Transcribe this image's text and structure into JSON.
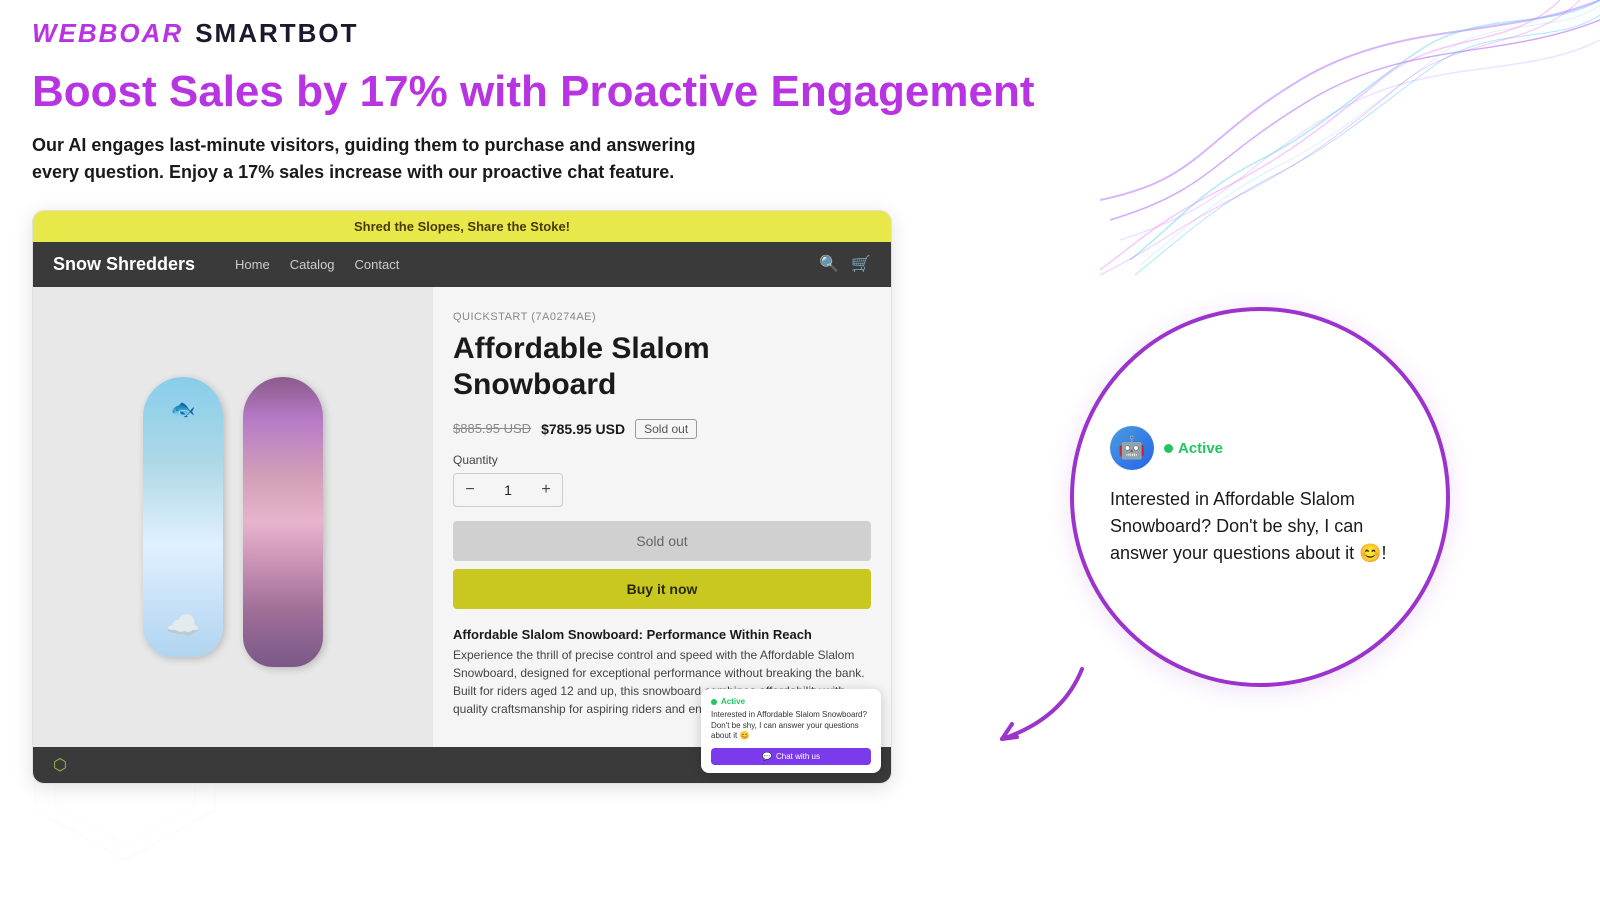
{
  "header": {
    "logo_webboar": "WEBBOAR",
    "logo_smartbot": "SMARTBOT"
  },
  "hero": {
    "title": "Boost Sales by 17% with Proactive Engagement",
    "description": "Our AI engages last-minute visitors, guiding them to purchase and answering every question. Enjoy a 17% sales increase with our proactive chat feature."
  },
  "store": {
    "announcement": "Shred the Slopes, Share the Stoke!",
    "logo": "Snow Shredders",
    "nav": {
      "home": "Home",
      "catalog": "Catalog",
      "contact": "Contact"
    },
    "product": {
      "sku": "QUICKSTART (7A0274AE)",
      "name": "Affordable Slalom Snowboard",
      "price_original": "$885.95 USD",
      "price_current": "$785.95 USD",
      "sold_out_badge": "Sold out",
      "quantity_label": "Quantity",
      "quantity_value": "1",
      "btn_sold_out": "Sold out",
      "btn_buy_now": "Buy it now",
      "desc_title": "Affordable Slalom Snowboard: Performance Within Reach",
      "desc_text": "Experience the thrill of precise control and speed with the Affordable Slalom Snowboard, designed for exceptional performance without breaking the bank. Built for riders aged 12 and up, this snowboard combines affordability with quality craftsmanship for aspiring riders and enthusiasts alike."
    }
  },
  "chat_widget": {
    "active_label": "Active",
    "message": "Interested in Affordable Slalom Snowboard? Don't be shy, I can answer your questions about it 😊!",
    "avatar_emoji": "🤖"
  },
  "mini_chat": {
    "active_label": "Active",
    "message_text": "Interested in Affordable Slalom Snowboard? Don't be shy, I can answer your questions about it 😊",
    "button_label": "Chat with us"
  }
}
